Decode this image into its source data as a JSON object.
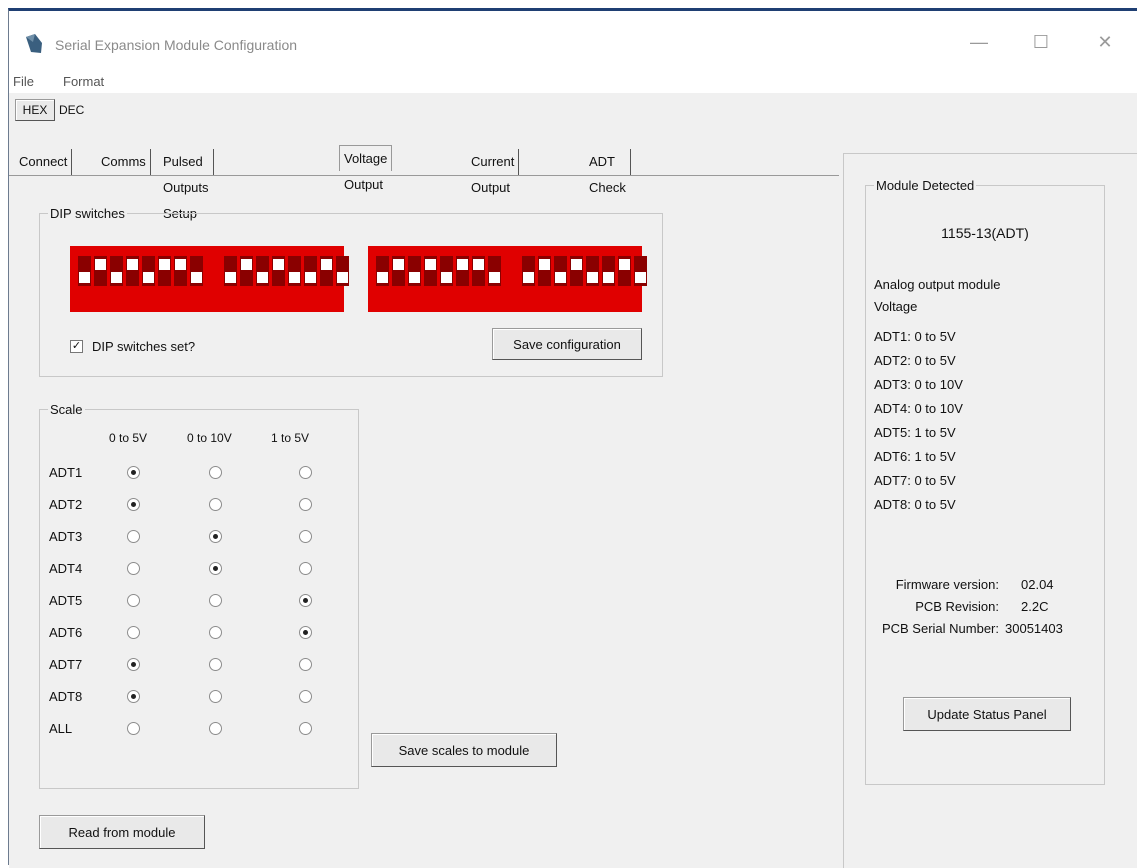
{
  "window": {
    "title": "Serial Expansion Module Configuration",
    "minimize": "—",
    "maximize": "☐",
    "close": "✕"
  },
  "menu": {
    "file": "File",
    "format": "Format"
  },
  "number_mode": {
    "hex": "HEX",
    "dec": "DEC"
  },
  "tabs": [
    "Connect",
    "Comms",
    "Pulsed Outputs Setup",
    "Voltage Output",
    "Current Output",
    "ADT Check"
  ],
  "active_tab": 3,
  "dip": {
    "legend": "DIP switches",
    "checkbox_label": "DIP switches set?",
    "checked": true,
    "save_button": "Save configuration"
  },
  "scale": {
    "legend": "Scale",
    "columns": [
      "0 to 5V",
      "0 to 10V",
      "1 to 5V"
    ],
    "rows": [
      {
        "label": "ADT1",
        "selected": 0
      },
      {
        "label": "ADT2",
        "selected": 0
      },
      {
        "label": "ADT3",
        "selected": 1
      },
      {
        "label": "ADT4",
        "selected": 1
      },
      {
        "label": "ADT5",
        "selected": 2
      },
      {
        "label": "ADT6",
        "selected": 2
      },
      {
        "label": "ADT7",
        "selected": 0
      },
      {
        "label": "ADT8",
        "selected": 0
      },
      {
        "label": "ALL",
        "selected": -1
      }
    ],
    "save_button": "Save scales to module"
  },
  "read_button": "Read from module",
  "status": {
    "legend": "Module Detected",
    "model": "1155-13(ADT)",
    "type_line1": "Analog output module",
    "type_line2": "Voltage",
    "outputs": [
      "ADT1: 0 to 5V",
      "ADT2: 0 to 5V",
      "ADT3: 0 to 10V",
      "ADT4: 0 to 10V",
      "ADT5: 1 to 5V",
      "ADT6: 1 to 5V",
      "ADT7: 0 to 5V",
      "ADT8: 0 to 5V"
    ],
    "firmware_label": "Firmware version:",
    "firmware_value": "02.04",
    "pcb_rev_label": "PCB Revision:",
    "pcb_rev_value": "2.2C",
    "serial_label": "PCB Serial Number:",
    "serial_value": "30051403",
    "update_button": "Update Status Panel"
  },
  "colors": {
    "dip_red": "#e00000",
    "title_bar": "#1f3f73"
  }
}
